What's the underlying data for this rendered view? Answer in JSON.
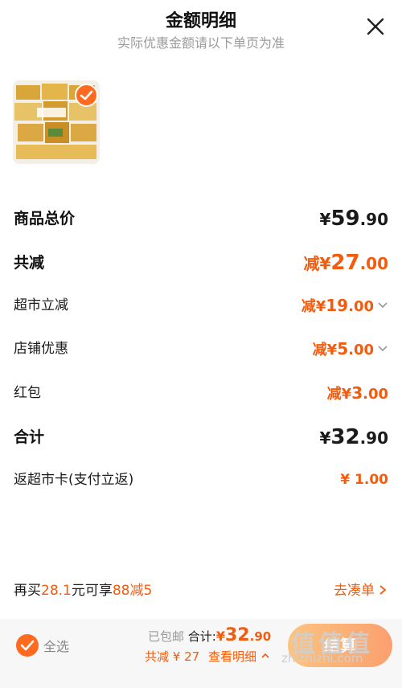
{
  "header": {
    "title": "金额明细",
    "subtitle": "实际优惠金额请以下单页为准"
  },
  "rows": {
    "goods_total": {
      "label": "商品总价",
      "symbol": "¥",
      "int": "59",
      "dec": ".90"
    },
    "total_reduce": {
      "label": "共减",
      "prefix": "减",
      "symbol": "¥",
      "int": "27",
      "dec": ".00"
    },
    "market_reduce": {
      "label": "超市立减",
      "prefix": "减",
      "symbol": "¥",
      "int": "19",
      "dec": ".00"
    },
    "store_discount": {
      "label": "店铺优惠",
      "prefix": "减",
      "symbol": "¥",
      "int": "5",
      "dec": ".00"
    },
    "red_packet": {
      "label": "红包",
      "prefix": "减",
      "symbol": "¥",
      "int": "3",
      "dec": ".00"
    },
    "sum": {
      "label": "合计",
      "symbol": "¥",
      "int": "32",
      "dec": ".90"
    },
    "cashback": {
      "label": "返超市卡(支付立返)",
      "value": "¥ 1.00"
    }
  },
  "promo": {
    "pre": "再买",
    "amount": "28.1",
    "mid": "元可享",
    "deal": "88减5",
    "link": "去凑单"
  },
  "bottom": {
    "select_all": "全选",
    "free_shipping": "已包邮",
    "total_label": "合计:",
    "total_symbol": "¥",
    "total_int": "32",
    "total_dec": ".90",
    "reduce_text": "共减 ¥ 27",
    "detail_link": "查看明细",
    "checkout": "结算"
  },
  "watermark": {
    "logo": "值值值",
    "url": "zhizhizhi.com"
  },
  "colors": {
    "accent": "#f35b0d",
    "badge": "#ff6a1f"
  },
  "icons": [
    "close-icon",
    "check-icon",
    "chevron-down-icon",
    "chevron-right-icon",
    "chevron-up-icon"
  ]
}
